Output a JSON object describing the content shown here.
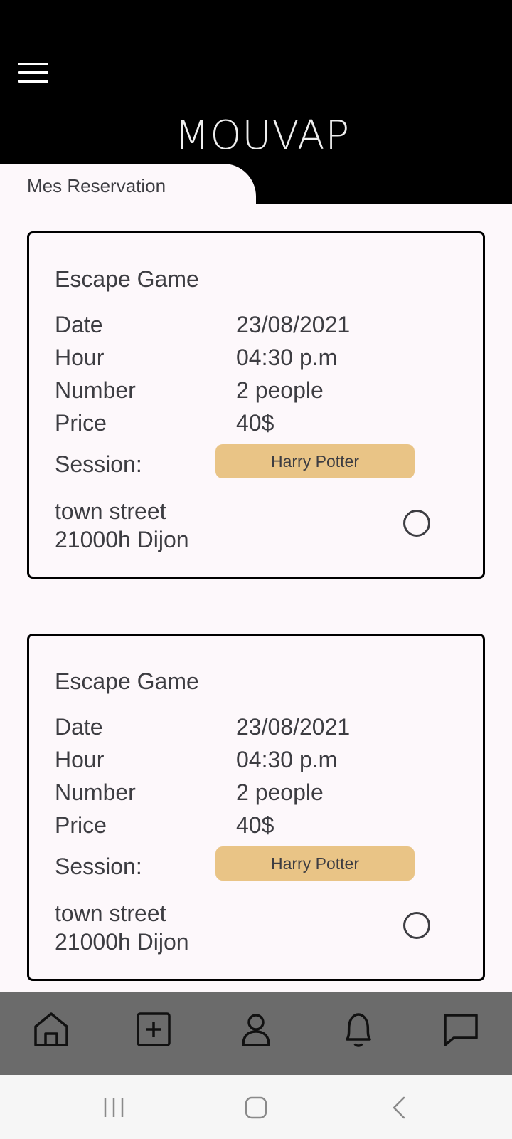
{
  "app": {
    "logo_text": "MOUVAP"
  },
  "header": {
    "page_title": "Mes Reservation"
  },
  "reservations": [
    {
      "title": "Escape Game",
      "date_label": "Date",
      "date_value": "23/08/2021",
      "hour_label": "Hour",
      "hour_value": "04:30 p.m",
      "number_label": "Number",
      "number_value": "2 people",
      "price_label": "Price",
      "price_value": "40$",
      "session_label": "Session:",
      "session_value": "Harry Potter",
      "address_line1": "town street",
      "address_line2": "21000h Dijon"
    },
    {
      "title": "Escape Game",
      "date_label": "Date",
      "date_value": "23/08/2021",
      "hour_label": "Hour",
      "hour_value": "04:30 p.m",
      "number_label": "Number",
      "number_value": "2 people",
      "price_label": "Price",
      "price_value": "40$",
      "session_label": "Session:",
      "session_value": "Harry Potter",
      "address_line1": "town street",
      "address_line2": "21000h Dijon"
    }
  ],
  "bottom_nav": {
    "items": [
      {
        "icon": "home-icon"
      },
      {
        "icon": "add-square-icon"
      },
      {
        "icon": "profile-icon"
      },
      {
        "icon": "bell-icon"
      },
      {
        "icon": "chat-icon"
      }
    ]
  },
  "system_nav": {
    "items": [
      "recents",
      "home",
      "back"
    ]
  },
  "colors": {
    "header_bg": "#000000",
    "page_bg": "#fdf8fb",
    "session_badge": "#e9c486",
    "bottom_nav_bg": "#6b6b6b",
    "system_nav_bg": "#f6f6f6"
  }
}
